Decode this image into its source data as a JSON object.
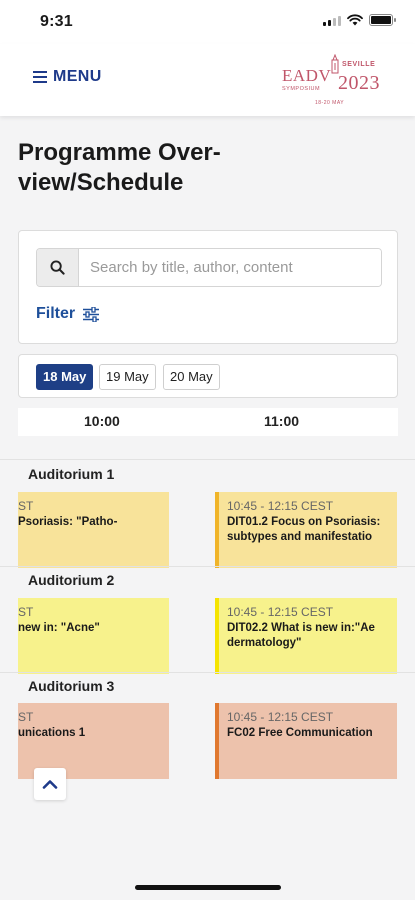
{
  "status": {
    "time": "9:31"
  },
  "header": {
    "menu_label": "MENU",
    "logo": {
      "brand": "EADV",
      "symposium": "SYMPOSIUM",
      "city": "SEVILLE",
      "year": "2023",
      "dates": "18-20 MAY"
    }
  },
  "page": {
    "title": "Programme Over-view/Schedule"
  },
  "search": {
    "placeholder": "Search by title, author, content"
  },
  "filter": {
    "label": "Filter"
  },
  "dates": [
    {
      "label": "18 May",
      "active": true
    },
    {
      "label": "19 May",
      "active": false
    },
    {
      "label": "20 May",
      "active": false
    }
  ],
  "timeline": {
    "times": [
      "10:00",
      "11:00"
    ]
  },
  "rooms": [
    {
      "name": "Auditorium 1",
      "color": "#f8e39a",
      "accent": "#f0b429",
      "left": {
        "time": "ST",
        "title": "Psoriasis: \"Patho-"
      },
      "right": {
        "time": "10:45 - 12:15 CEST",
        "title_1": "DIT01.2 Focus on Psoriasis:",
        "title_2": "subtypes and manifestatio"
      }
    },
    {
      "name": "Auditorium 2",
      "color": "#f7f28c",
      "accent": "#f5e400",
      "left": {
        "time": "ST",
        "title": "new in: \"Acne\""
      },
      "right": {
        "time": "10:45 - 12:15 CEST",
        "title_1": "DIT02.2 What is new in:\"Ae",
        "title_2": "dermatology\""
      }
    },
    {
      "name": "Auditorium 3",
      "color": "#edc2ac",
      "accent": "#e0782f",
      "left": {
        "time": "ST",
        "title": "unications 1"
      },
      "right": {
        "time": "10:45 - 12:15 CEST",
        "title_1": "FC02 Free Communication",
        "title_2": ""
      }
    }
  ]
}
